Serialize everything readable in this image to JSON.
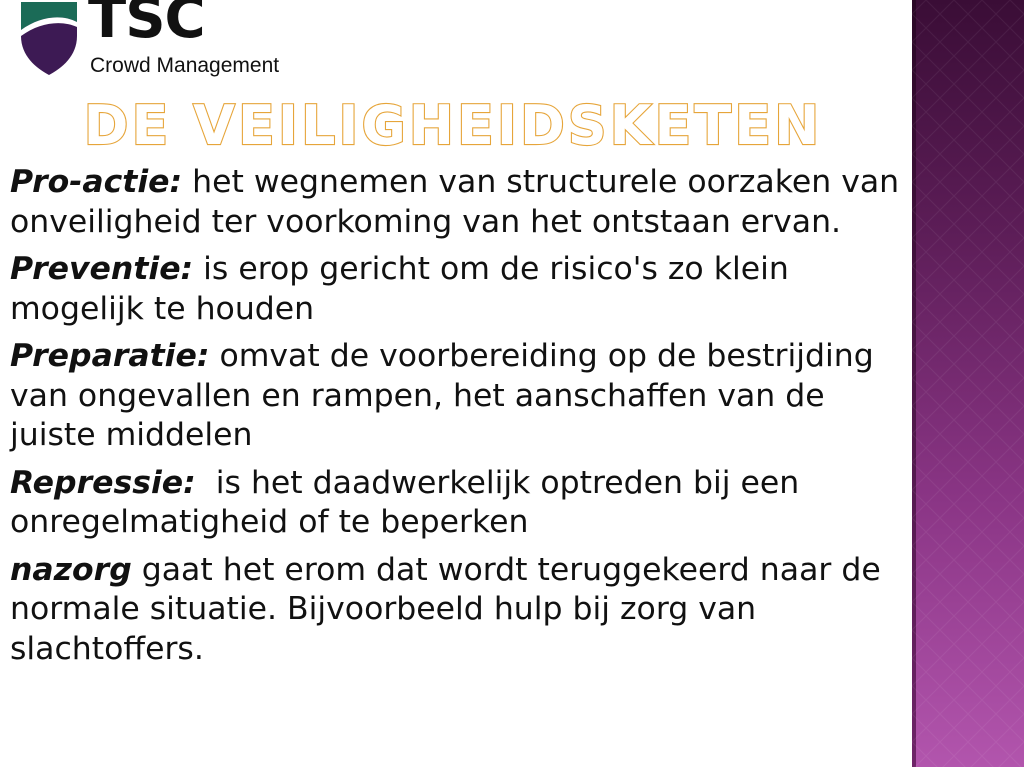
{
  "logo": {
    "name": "TSC",
    "subtitle": "Crowd Management",
    "colors": {
      "shield_dark": "#3d1a54",
      "shield_accent": "#1b6b57"
    }
  },
  "title": "DE VEILIGHEIDSKETEN",
  "colors": {
    "title_fill": "#ffffff",
    "title_stroke": "#e6a53a",
    "side_band": "#6e2468",
    "text": "#111111"
  },
  "paragraphs": [
    {
      "term": "Pro-actie:",
      "text": " het wegnemen van structurele oorzaken van onveiligheid ter voorkoming van het ontstaan ervan."
    },
    {
      "term": "Preventie:",
      "text": " is erop gericht om de risico's zo klein mogelijk te houden"
    },
    {
      "term": "Preparatie:",
      "text": " omvat de voorbereiding op de bestrijding van ongevallen en rampen, het aanschaffen van de juiste middelen"
    },
    {
      "term": "Repressie:",
      "text": "  is het daadwerkelijk optreden bij een onregelmatigheid of te beperken"
    },
    {
      "term": "nazorg",
      "text": " gaat het erom dat wordt teruggekeerd naar de normale situatie. Bijvoorbeeld hulp bij zorg van slachtoffers."
    }
  ]
}
